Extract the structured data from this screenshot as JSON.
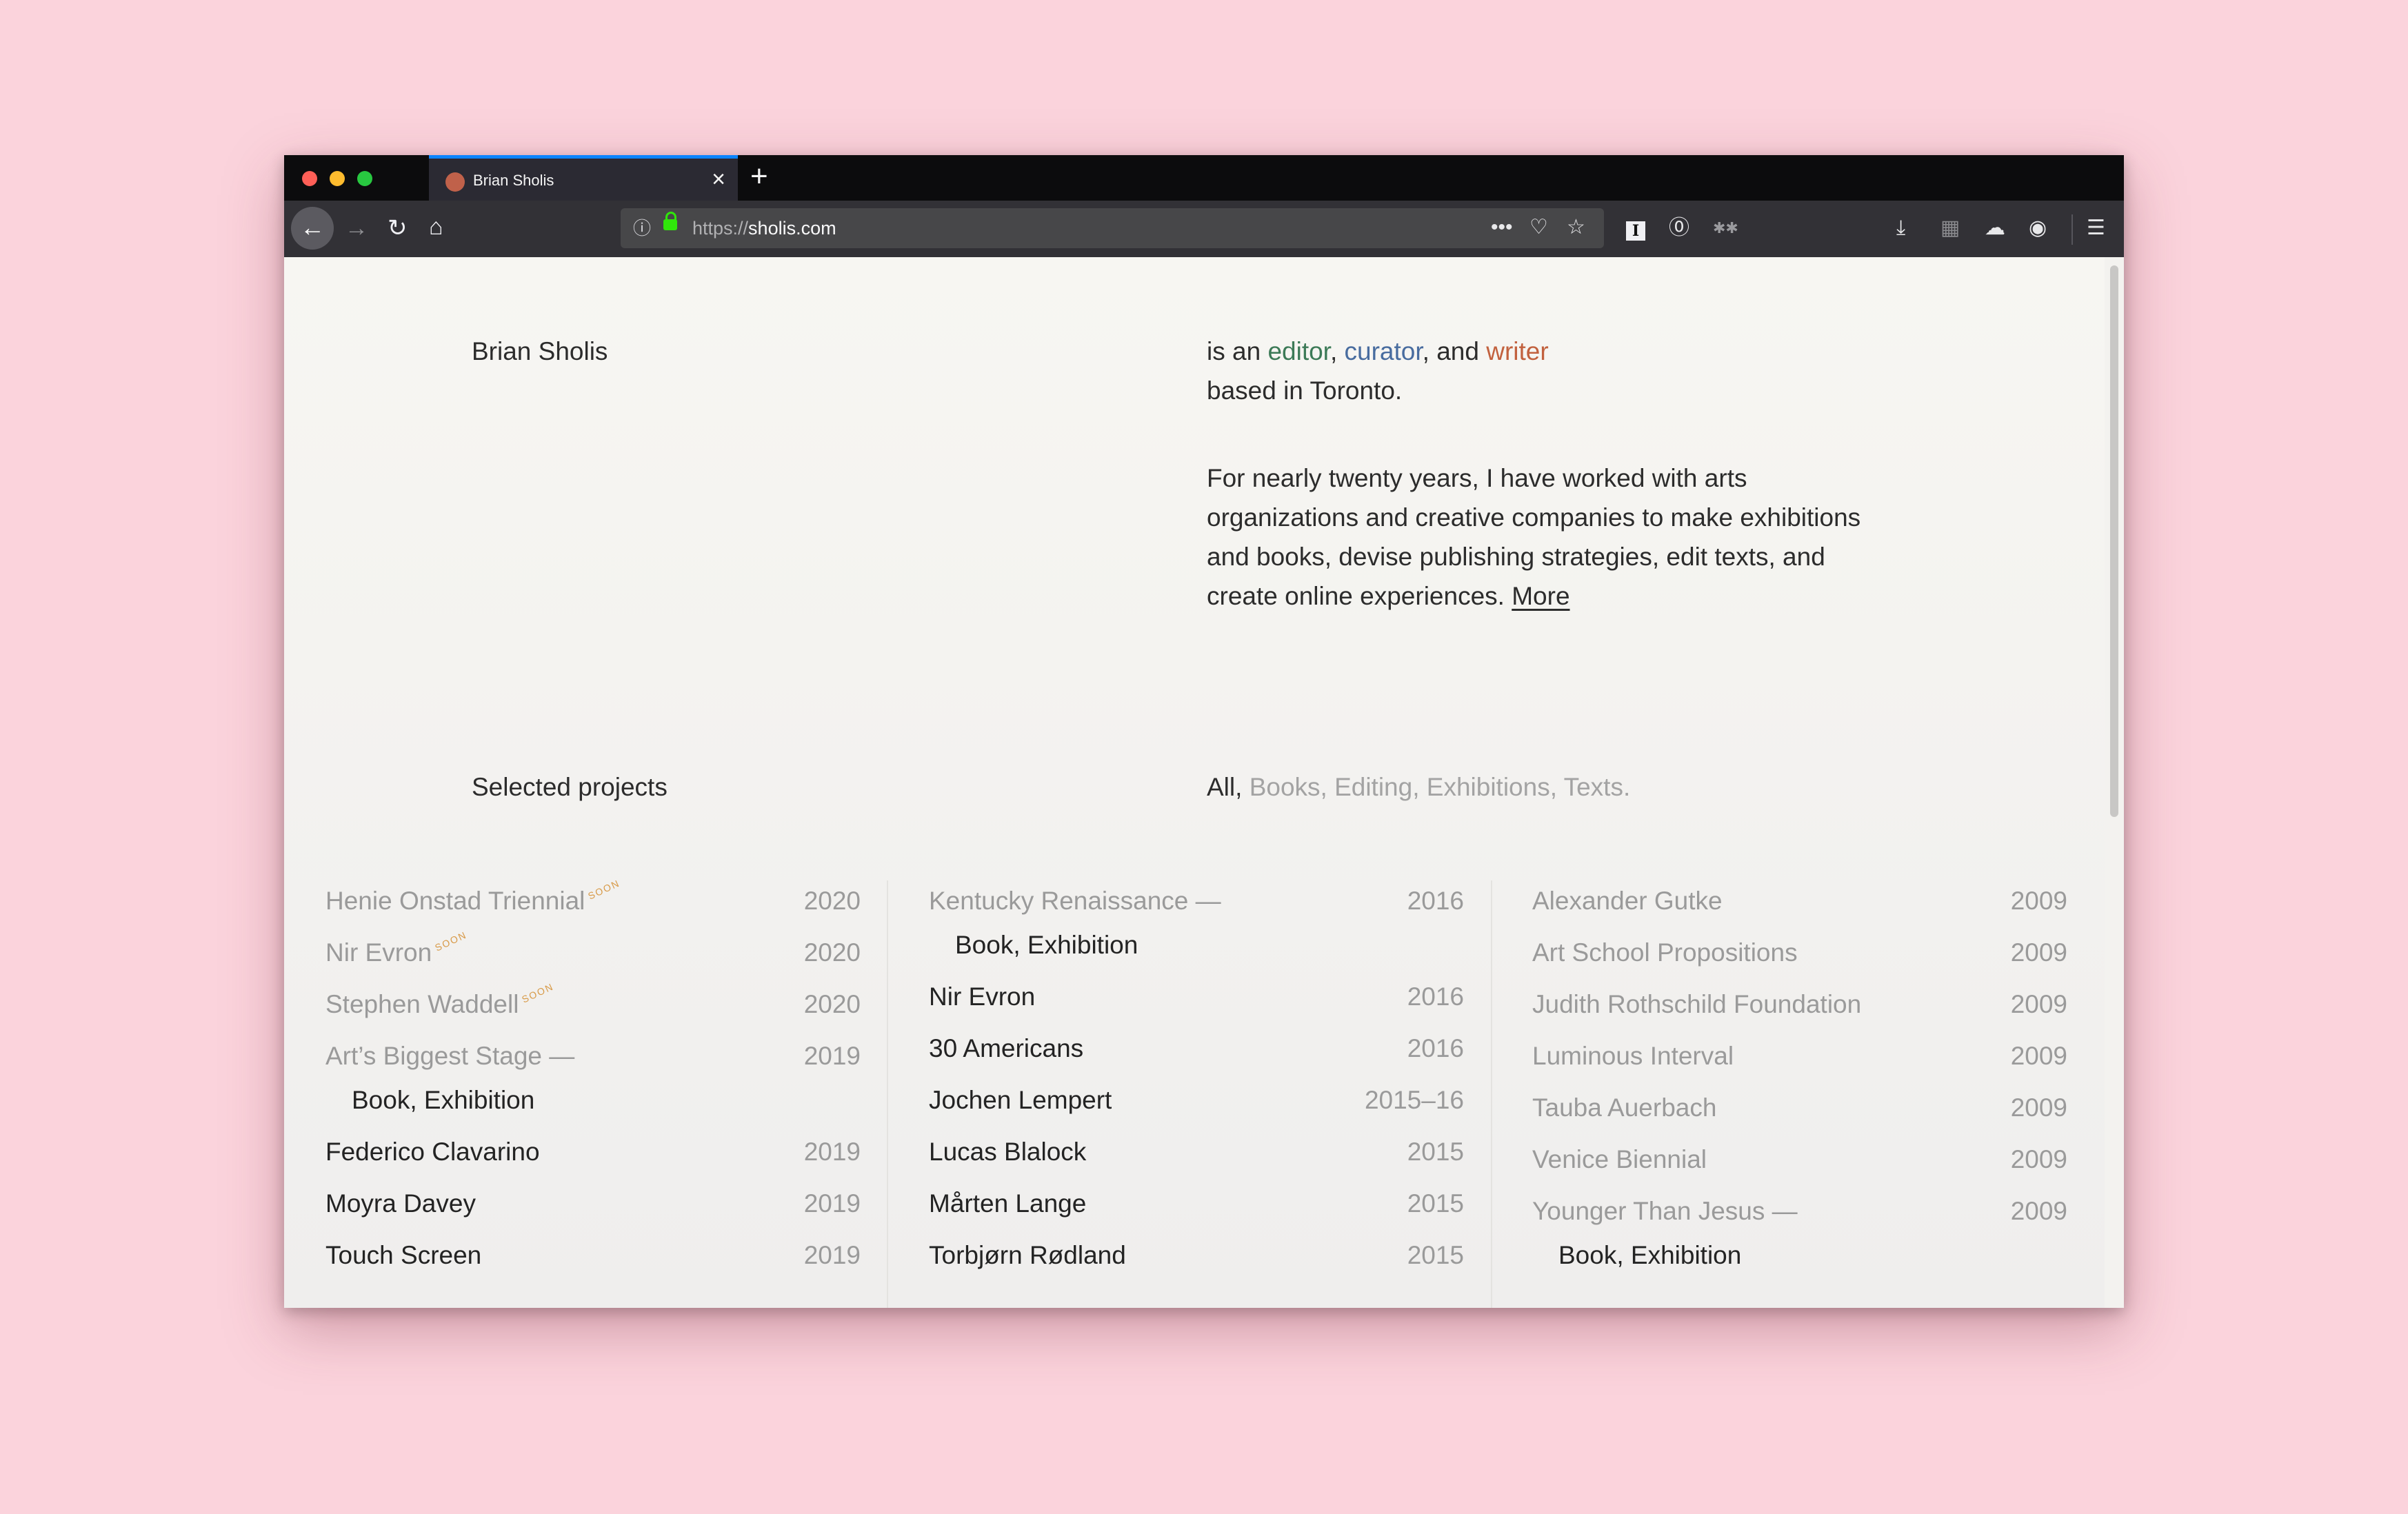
{
  "browser": {
    "tab_title": "Brian Sholis",
    "tab_close": "×",
    "new_tab": "+",
    "url_scheme": "https://",
    "url_host": "sholis.com",
    "icons": [
      "back-arrow-icon",
      "forward-arrow-icon",
      "reload-icon",
      "home-icon",
      "info-icon",
      "lock-icon",
      "more-dots-icon",
      "pocket-icon",
      "bookmark-star-icon",
      "instapaper-icon",
      "1password-icon",
      "extension-icon",
      "download-icon",
      "library-icon",
      "sync-icon",
      "account-icon",
      "menu-icon"
    ],
    "accent_color": "#0a84ff"
  },
  "header": {
    "name": "Brian Sholis",
    "intro_prefix": "is an ",
    "role_editor": "editor",
    "sep1": ", ",
    "role_curator": "curator",
    "sep2": ", and ",
    "role_writer": "writer",
    "intro_line2": "based in Toronto.",
    "bio": "For nearly twenty years, I have worked with arts organizations and creative companies to make exhibitions and books, devise publishing strategies, edit texts, and create online experiences.",
    "more_link": "More",
    "colors": {
      "editor": "#3c7a57",
      "curator": "#486c9f",
      "writer": "#c2613e"
    }
  },
  "projects": {
    "heading": "Selected projects",
    "filter_all": "All,",
    "filter_rest": "Books, Editing, Exhibitions, Texts.",
    "soon_label": "SOON",
    "col1": [
      {
        "title": "Henie Onstad Triennial",
        "year": "2020",
        "dim": true,
        "soon": true
      },
      {
        "title": "Nir Evron",
        "year": "2020",
        "dim": true,
        "soon": true
      },
      {
        "title": "Stephen Waddell",
        "year": "2020",
        "dim": true,
        "soon": true
      },
      {
        "title": "Art’s Biggest Stage —",
        "year": "2019",
        "dim": true,
        "sub": "Book, Exhibition"
      },
      {
        "title": "Federico Clavarino",
        "year": "2019"
      },
      {
        "title": "Moyra Davey",
        "year": "2019"
      },
      {
        "title": "Touch Screen",
        "year": "2019"
      }
    ],
    "col2": [
      {
        "title": "Kentucky Renaissance —",
        "year": "2016",
        "dim": true,
        "sub": "Book, Exhibition"
      },
      {
        "title": "Nir Evron",
        "year": "2016"
      },
      {
        "title": "30 Americans",
        "year": "2016"
      },
      {
        "title": "Jochen Lempert",
        "year": "2015–16"
      },
      {
        "title": "Lucas Blalock",
        "year": "2015"
      },
      {
        "title": "Mårten Lange",
        "year": "2015"
      },
      {
        "title": "Torbjørn Rødland",
        "year": "2015"
      }
    ],
    "col3": [
      {
        "title": "Alexander Gutke",
        "year": "2009",
        "dim": true
      },
      {
        "title": "Art School Propositions",
        "year": "2009",
        "dim": true
      },
      {
        "title": "Judith Rothschild Foundation",
        "year": "2009",
        "dim": true
      },
      {
        "title": "Luminous Interval",
        "year": "2009",
        "dim": true
      },
      {
        "title": "Tauba Auerbach",
        "year": "2009",
        "dim": true
      },
      {
        "title": "Venice Biennial",
        "year": "2009",
        "dim": true
      },
      {
        "title": "Younger Than Jesus —",
        "year": "2009",
        "dim": true,
        "sub": "Book, Exhibition"
      }
    ]
  }
}
